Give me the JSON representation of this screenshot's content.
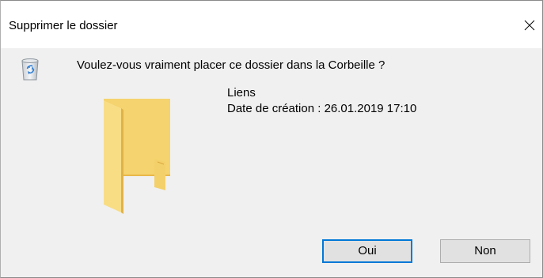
{
  "window": {
    "title": "Supprimer le dossier",
    "close_icon": "close-icon"
  },
  "dialog": {
    "question": "Voulez-vous vraiment placer ce dossier dans la Corbeille ?",
    "dialog_icon": "recycle-bin-icon",
    "item_icon": "folder-icon",
    "item": {
      "name": "Liens",
      "date": "Date de création : 26.01.2019 17:10"
    }
  },
  "buttons": {
    "yes_label": "Oui",
    "no_label": "Non"
  },
  "colors": {
    "default_button_border": "#0078d7",
    "folder": "#f8d775",
    "dialog_background": "#f0f0f0"
  }
}
